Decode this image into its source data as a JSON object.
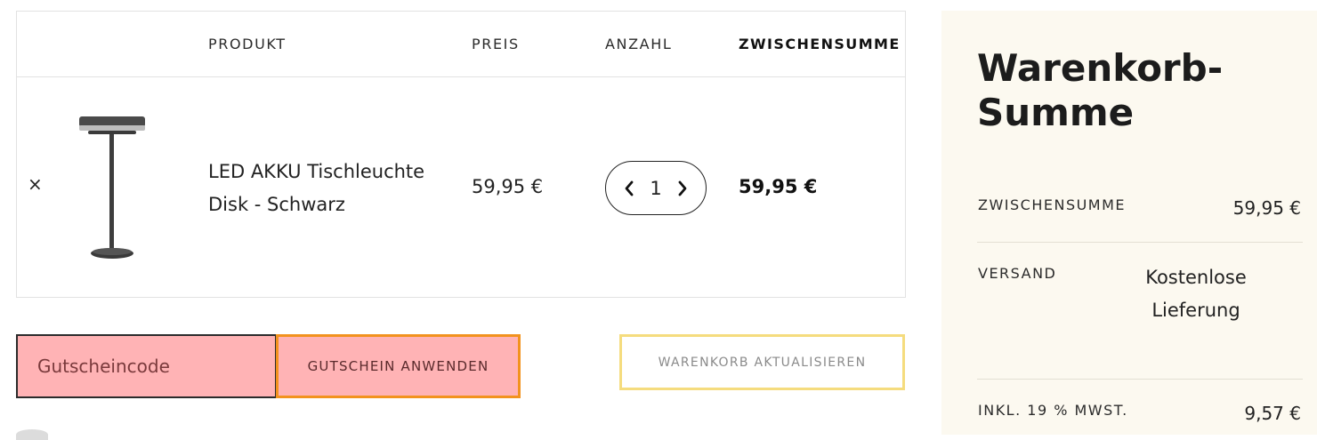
{
  "cart": {
    "headers": {
      "product": "PRODUKT",
      "price": "PREIS",
      "quantity": "ANZAHL",
      "subtotal": "ZWISCHENSUMME"
    },
    "remove_symbol": "×",
    "item": {
      "name": "LED AKKU Tischleuchte Disk - Schwarz",
      "price": "59,95 €",
      "quantity": "1",
      "subtotal": "59,95 €",
      "image_icon": "table-lamp-image"
    }
  },
  "coupon": {
    "placeholder": "Gutscheincode",
    "apply_label": "GUTSCHEIN ANWENDEN"
  },
  "update_label": "WARENKORB AKTUALISIEREN",
  "totals": {
    "title": "Warenkorb-Summe",
    "subtotal_label": "ZWISCHENSUMME",
    "subtotal_value": "59,95 €",
    "shipping_label": "VERSAND",
    "shipping_value": "Kostenlose Lieferung",
    "tax_label": "INKL. 19 % MWST.",
    "tax_value": "9,57 €"
  },
  "colors": {
    "panel_bg": "#fcf9f0",
    "coupon_bg": "#ffb3b5",
    "coupon_button_border": "#f2921e",
    "update_button_border": "#f5dc7e"
  }
}
